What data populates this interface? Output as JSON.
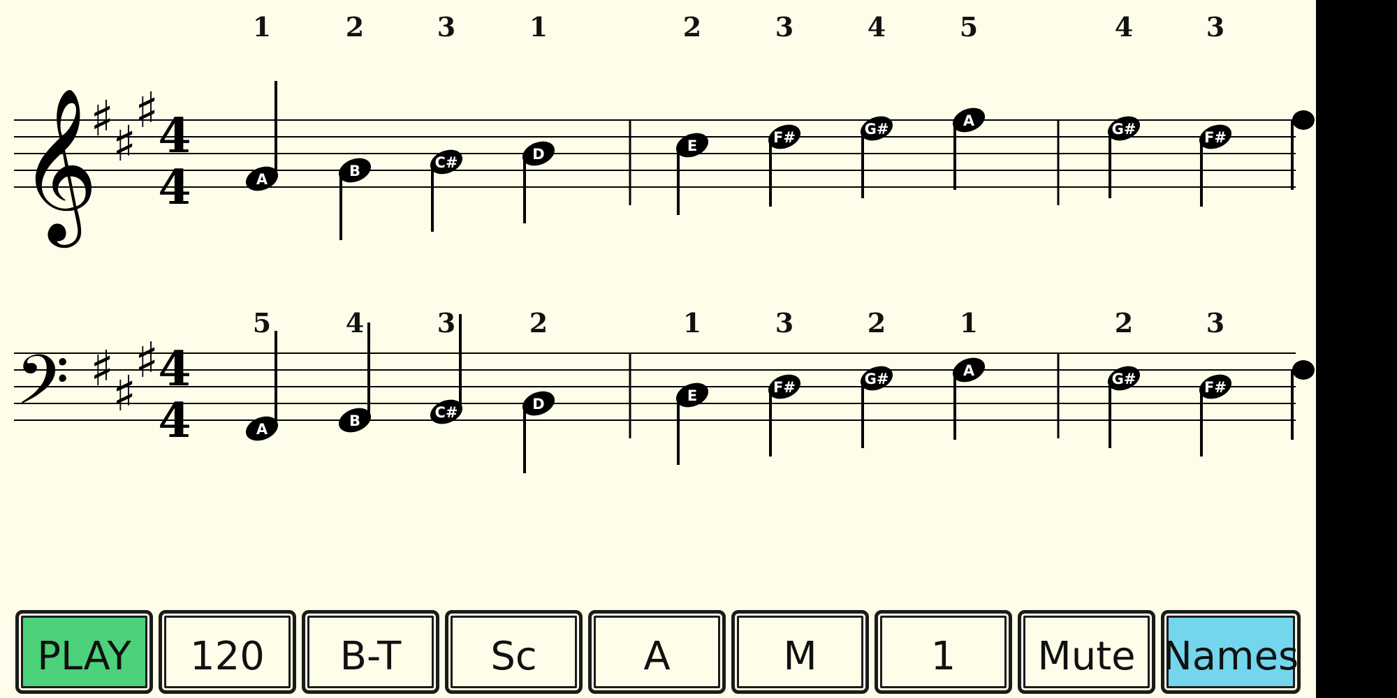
{
  "colors": {
    "background": "#fdfde9",
    "play_button": "#4cd27a",
    "names_button": "#74d6ec",
    "ink": "#000000"
  },
  "score": {
    "staves": [
      {
        "clef": "treble",
        "clef_icon": "treble-clef-icon",
        "key_signature": [
          "F#",
          "C#",
          "G#"
        ],
        "time_signature": {
          "top": "4",
          "bottom": "4"
        },
        "notes": [
          {
            "name": "A",
            "fingering": "1",
            "stem": "up"
          },
          {
            "name": "B",
            "fingering": "2",
            "stem": "down"
          },
          {
            "name": "C#",
            "fingering": "3",
            "stem": "down"
          },
          {
            "name": "D",
            "fingering": "1",
            "stem": "down"
          },
          {
            "name": "E",
            "fingering": "2",
            "stem": "down"
          },
          {
            "name": "F#",
            "fingering": "3",
            "stem": "down"
          },
          {
            "name": "G#",
            "fingering": "4",
            "stem": "down"
          },
          {
            "name": "A",
            "fingering": "5",
            "stem": "down"
          },
          {
            "name": "G#",
            "fingering": "4",
            "stem": "down"
          },
          {
            "name": "F#",
            "fingering": "3",
            "stem": "down"
          }
        ]
      },
      {
        "clef": "bass",
        "clef_icon": "bass-clef-icon",
        "key_signature": [
          "F#",
          "C#",
          "G#"
        ],
        "time_signature": {
          "top": "4",
          "bottom": "4"
        },
        "notes": [
          {
            "name": "A",
            "fingering": "5",
            "stem": "up"
          },
          {
            "name": "B",
            "fingering": "4",
            "stem": "up"
          },
          {
            "name": "C#",
            "fingering": "3",
            "stem": "up"
          },
          {
            "name": "D",
            "fingering": "2",
            "stem": "down"
          },
          {
            "name": "E",
            "fingering": "1",
            "stem": "down"
          },
          {
            "name": "F#",
            "fingering": "3",
            "stem": "down"
          },
          {
            "name": "G#",
            "fingering": "2",
            "stem": "down"
          },
          {
            "name": "A",
            "fingering": "1",
            "stem": "down"
          },
          {
            "name": "G#",
            "fingering": "2",
            "stem": "down"
          },
          {
            "name": "F#",
            "fingering": "3",
            "stem": "down"
          }
        ]
      }
    ]
  },
  "toolbar": {
    "buttons": [
      {
        "id": "play",
        "label": "PLAY"
      },
      {
        "id": "tempo",
        "label": "120"
      },
      {
        "id": "hands",
        "label": "B-T"
      },
      {
        "id": "mode",
        "label": "Sc"
      },
      {
        "id": "key",
        "label": "A"
      },
      {
        "id": "scale",
        "label": "M"
      },
      {
        "id": "octave",
        "label": "1"
      },
      {
        "id": "mute",
        "label": "Mute"
      },
      {
        "id": "names",
        "label": "Names"
      }
    ]
  }
}
